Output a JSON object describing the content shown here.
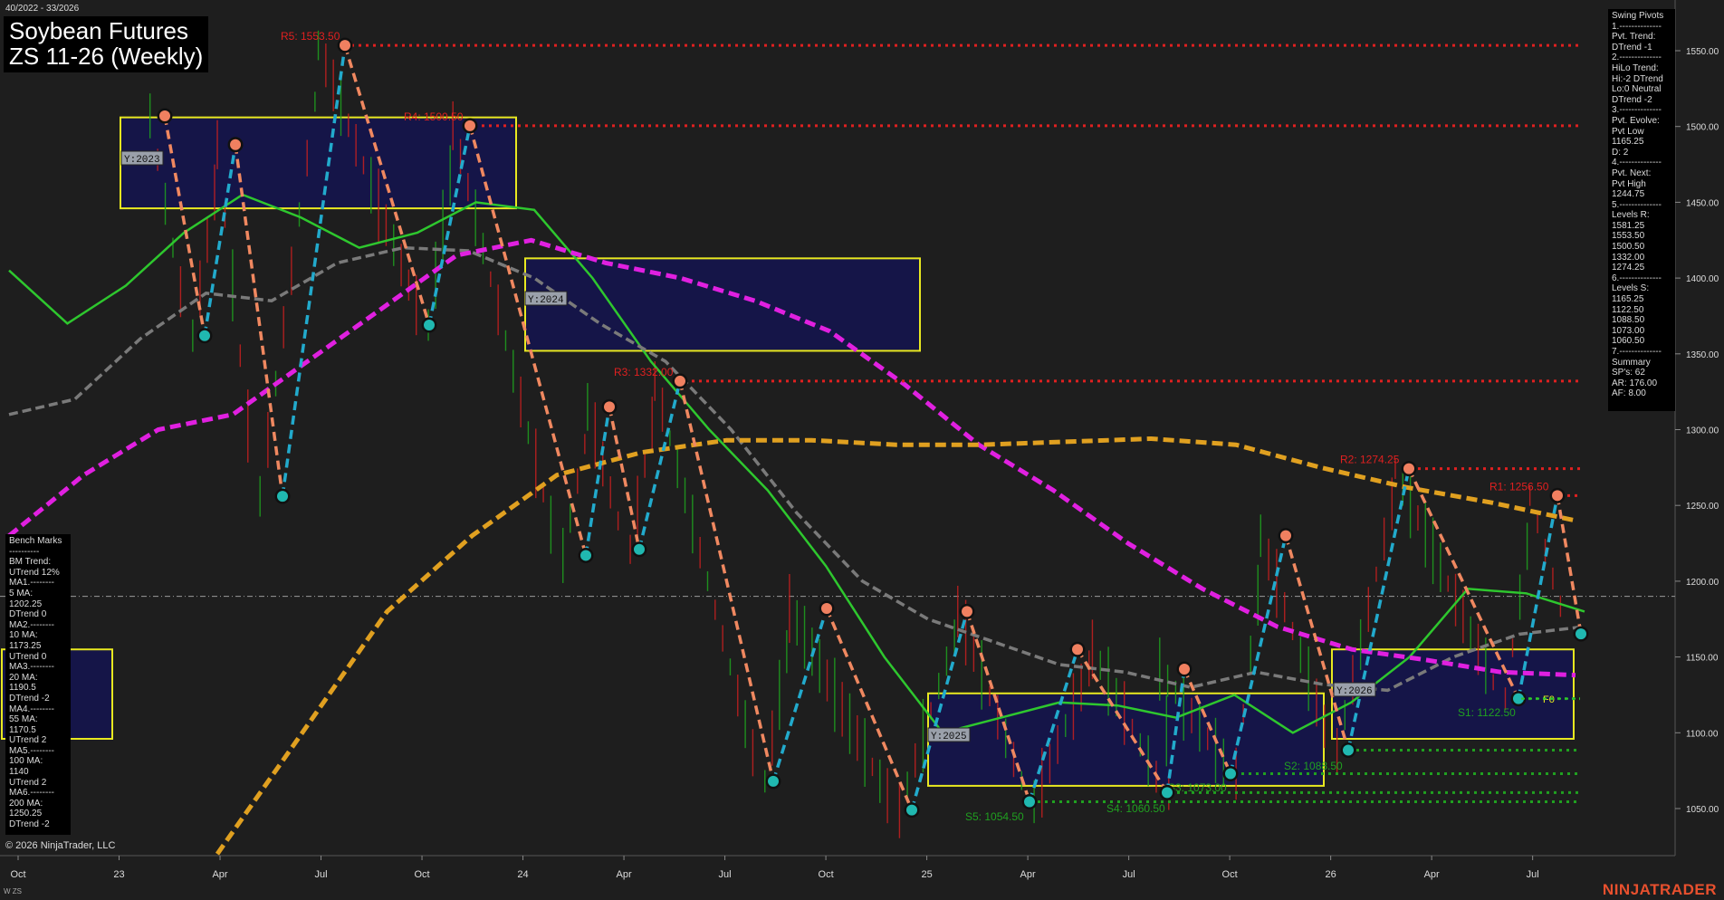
{
  "header": {
    "date_range": "40/2022 - 33/2026",
    "title_line1": "Soybean Futures",
    "title_line2": "ZS 11-26 (Weekly)"
  },
  "footer": {
    "copyright": "© 2026 NinjaTrader, LLC",
    "brand": "NINJATRADER",
    "symbol_tag": "W ZS"
  },
  "swing_pivots_panel": [
    "Swing Pivots",
    "1.--------------",
    "Pvt. Trend:",
    "DTrend -1",
    "2.--------------",
    "HiLo Trend:",
    "Hi:-2 DTrend",
    "Lo:0 Neutral",
    "DTrend -2",
    "3.--------------",
    "Pvt. Evolve:",
    "Pvt Low",
    "1165.25",
    "D: 2",
    "4.--------------",
    "Pvt. Next:",
    "Pvt High",
    "1244.75",
    "5.--------------",
    "Levels R:",
    "1581.25",
    "1553.50",
    "1500.50",
    "1332.00",
    "1274.25",
    "6.--------------",
    "Levels S:",
    "1165.25",
    "1122.50",
    "1088.50",
    "1073.00",
    "1060.50",
    "7.--------------",
    "Summary",
    "SP's: 62",
    "AR: 176.00",
    "AF: 8.00"
  ],
  "benchmarks_panel": [
    "Bench Marks",
    "----------",
    "BM Trend:",
    "UTrend 12%",
    "MA1.--------",
    "5 MA:",
    "1202.25",
    "DTrend 0",
    "MA2.--------",
    "10 MA:",
    "1173.25",
    "UTrend 0",
    "MA3.--------",
    "20 MA:",
    "1190.5",
    "DTrend -2",
    "MA4.--------",
    "55 MA:",
    "1170.5",
    "UTrend 2",
    "MA5.--------",
    "100 MA:",
    "1140",
    "UTrend 2",
    "MA6.--------",
    "200 MA:",
    "1250.25",
    "DTrend -2"
  ],
  "chart_data": {
    "type": "line",
    "title": "Soybean Futures ZS 11-26 (Weekly)",
    "ylim": [
      1020,
      1580
    ],
    "y_ticks": [
      1050,
      1100,
      1150,
      1200,
      1250,
      1300,
      1350,
      1400,
      1450,
      1500,
      1550
    ],
    "y_tick_labels": [
      "1050.00",
      "1100.00",
      "1150.00",
      "1200.00",
      "1250.00",
      "1300.00",
      "1350.00",
      "1400.00",
      "1450.00",
      "1500.00",
      "1550.00"
    ],
    "x_tick_labels": [
      "Oct",
      "23",
      "Apr",
      "Jul",
      "Oct",
      "24",
      "Apr",
      "Jul",
      "Oct",
      "25",
      "Apr",
      "Jul",
      "Oct",
      "26",
      "Apr",
      "Jul"
    ],
    "current_price": 1190,
    "resistance_levels": [
      {
        "label": "R5: 1553.50",
        "value": 1553.5
      },
      {
        "label": "R4: 1500.50",
        "value": 1500.5
      },
      {
        "label": "R3: 1332.00",
        "value": 1332.0
      },
      {
        "label": "R2: 1274.25",
        "value": 1274.25
      },
      {
        "label": "R1: 1256.50",
        "value": 1256.5
      }
    ],
    "support_levels": [
      {
        "label": "S1: 1122.50",
        "value": 1122.5
      },
      {
        "label": "S2: 1088.50",
        "value": 1088.5
      },
      {
        "label": "S3: 1073.00",
        "value": 1073.0
      },
      {
        "label": "S4: 1060.50",
        "value": 1060.5
      },
      {
        "label": "S5: 1054.50",
        "value": 1054.5
      }
    ],
    "year_boxes": [
      {
        "label": "Y:2023",
        "high": 1506,
        "low": 1446
      },
      {
        "label": "Y:2024",
        "high": 1413,
        "low": 1352
      },
      {
        "label": "Y:2025",
        "high": 1126,
        "low": 1065
      },
      {
        "label": "Y:2026",
        "high": 1155,
        "low": 1096
      }
    ],
    "fib_label": "F0",
    "swing_pivots": [
      {
        "date": "2023-02",
        "value": 1507,
        "type": "high"
      },
      {
        "date": "2023-03",
        "value": 1362,
        "type": "low"
      },
      {
        "date": "2023-04",
        "value": 1488,
        "type": "high"
      },
      {
        "date": "2023-05",
        "value": 1256,
        "type": "low"
      },
      {
        "date": "2023-07",
        "value": 1553.5,
        "type": "high"
      },
      {
        "date": "2023-10",
        "value": 1369,
        "type": "low"
      },
      {
        "date": "2023-11",
        "value": 1500.5,
        "type": "high"
      },
      {
        "date": "2024-02",
        "value": 1217,
        "type": "low"
      },
      {
        "date": "2024-03",
        "value": 1315,
        "type": "high"
      },
      {
        "date": "2024-04",
        "value": 1221,
        "type": "low"
      },
      {
        "date": "2024-05",
        "value": 1332,
        "type": "high"
      },
      {
        "date": "2024-08",
        "value": 1068,
        "type": "low"
      },
      {
        "date": "2024-09",
        "value": 1182,
        "type": "high"
      },
      {
        "date": "2024-12",
        "value": 1049,
        "type": "low"
      },
      {
        "date": "2025-02",
        "value": 1180,
        "type": "high"
      },
      {
        "date": "2025-04",
        "value": 1054.5,
        "type": "low"
      },
      {
        "date": "2025-06",
        "value": 1155,
        "type": "high"
      },
      {
        "date": "2025-08",
        "value": 1060.5,
        "type": "low"
      },
      {
        "date": "2025-08",
        "value": 1142,
        "type": "high"
      },
      {
        "date": "2025-10",
        "value": 1073,
        "type": "low"
      },
      {
        "date": "2025-11",
        "value": 1230,
        "type": "high"
      },
      {
        "date": "2026-01",
        "value": 1088.5,
        "type": "low"
      },
      {
        "date": "2026-03",
        "value": 1274.25,
        "type": "high"
      },
      {
        "date": "2026-06",
        "value": 1122.5,
        "type": "low"
      },
      {
        "date": "2026-07",
        "value": 1256.5,
        "type": "high"
      },
      {
        "date": "2026-08",
        "value": 1165.25,
        "type": "low"
      }
    ],
    "moving_averages": [
      {
        "name": "green MA",
        "color": "#2ec72e",
        "values": [
          1405,
          1370,
          1395,
          1430,
          1455,
          1440,
          1420,
          1430,
          1450,
          1445,
          1400,
          1345,
          1300,
          1260,
          1210,
          1150,
          1100,
          1110,
          1120,
          1118,
          1110,
          1125,
          1100,
          1120,
          1150,
          1195,
          1192,
          1180
        ]
      },
      {
        "name": "gray MA",
        "color": "#7a7a7a",
        "values": [
          1310,
          1320,
          1360,
          1390,
          1385,
          1410,
          1420,
          1418,
          1400,
          1370,
          1345,
          1300,
          1245,
          1200,
          1175,
          1160,
          1145,
          1140,
          1130,
          1140,
          1132,
          1128,
          1150,
          1165,
          1170
        ]
      },
      {
        "name": "magenta MA",
        "color": "#e020e0",
        "values": [
          1230,
          1270,
          1300,
          1310,
          1345,
          1380,
          1415,
          1425,
          1410,
          1400,
          1385,
          1365,
          1330,
          1290,
          1260,
          1225,
          1195,
          1170,
          1155,
          1148,
          1140,
          1138
        ]
      },
      {
        "name": "orange MA",
        "color": "#e0a020",
        "values": [
          1020,
          1100,
          1180,
          1230,
          1270,
          1285,
          1293,
          1293,
          1290,
          1290,
          1292,
          1294,
          1290,
          1275,
          1262,
          1252,
          1240
        ]
      }
    ]
  },
  "colors": {
    "background": "#1e1e1e",
    "resistance": "#e02020",
    "support": "#20a020",
    "year_box_border": "#e8e820",
    "year_box_fill": "#141450",
    "pivot_high": "#f08060",
    "pivot_low": "#20b8b0",
    "up_leg": "#22aacc",
    "down_leg": "#f08860"
  }
}
